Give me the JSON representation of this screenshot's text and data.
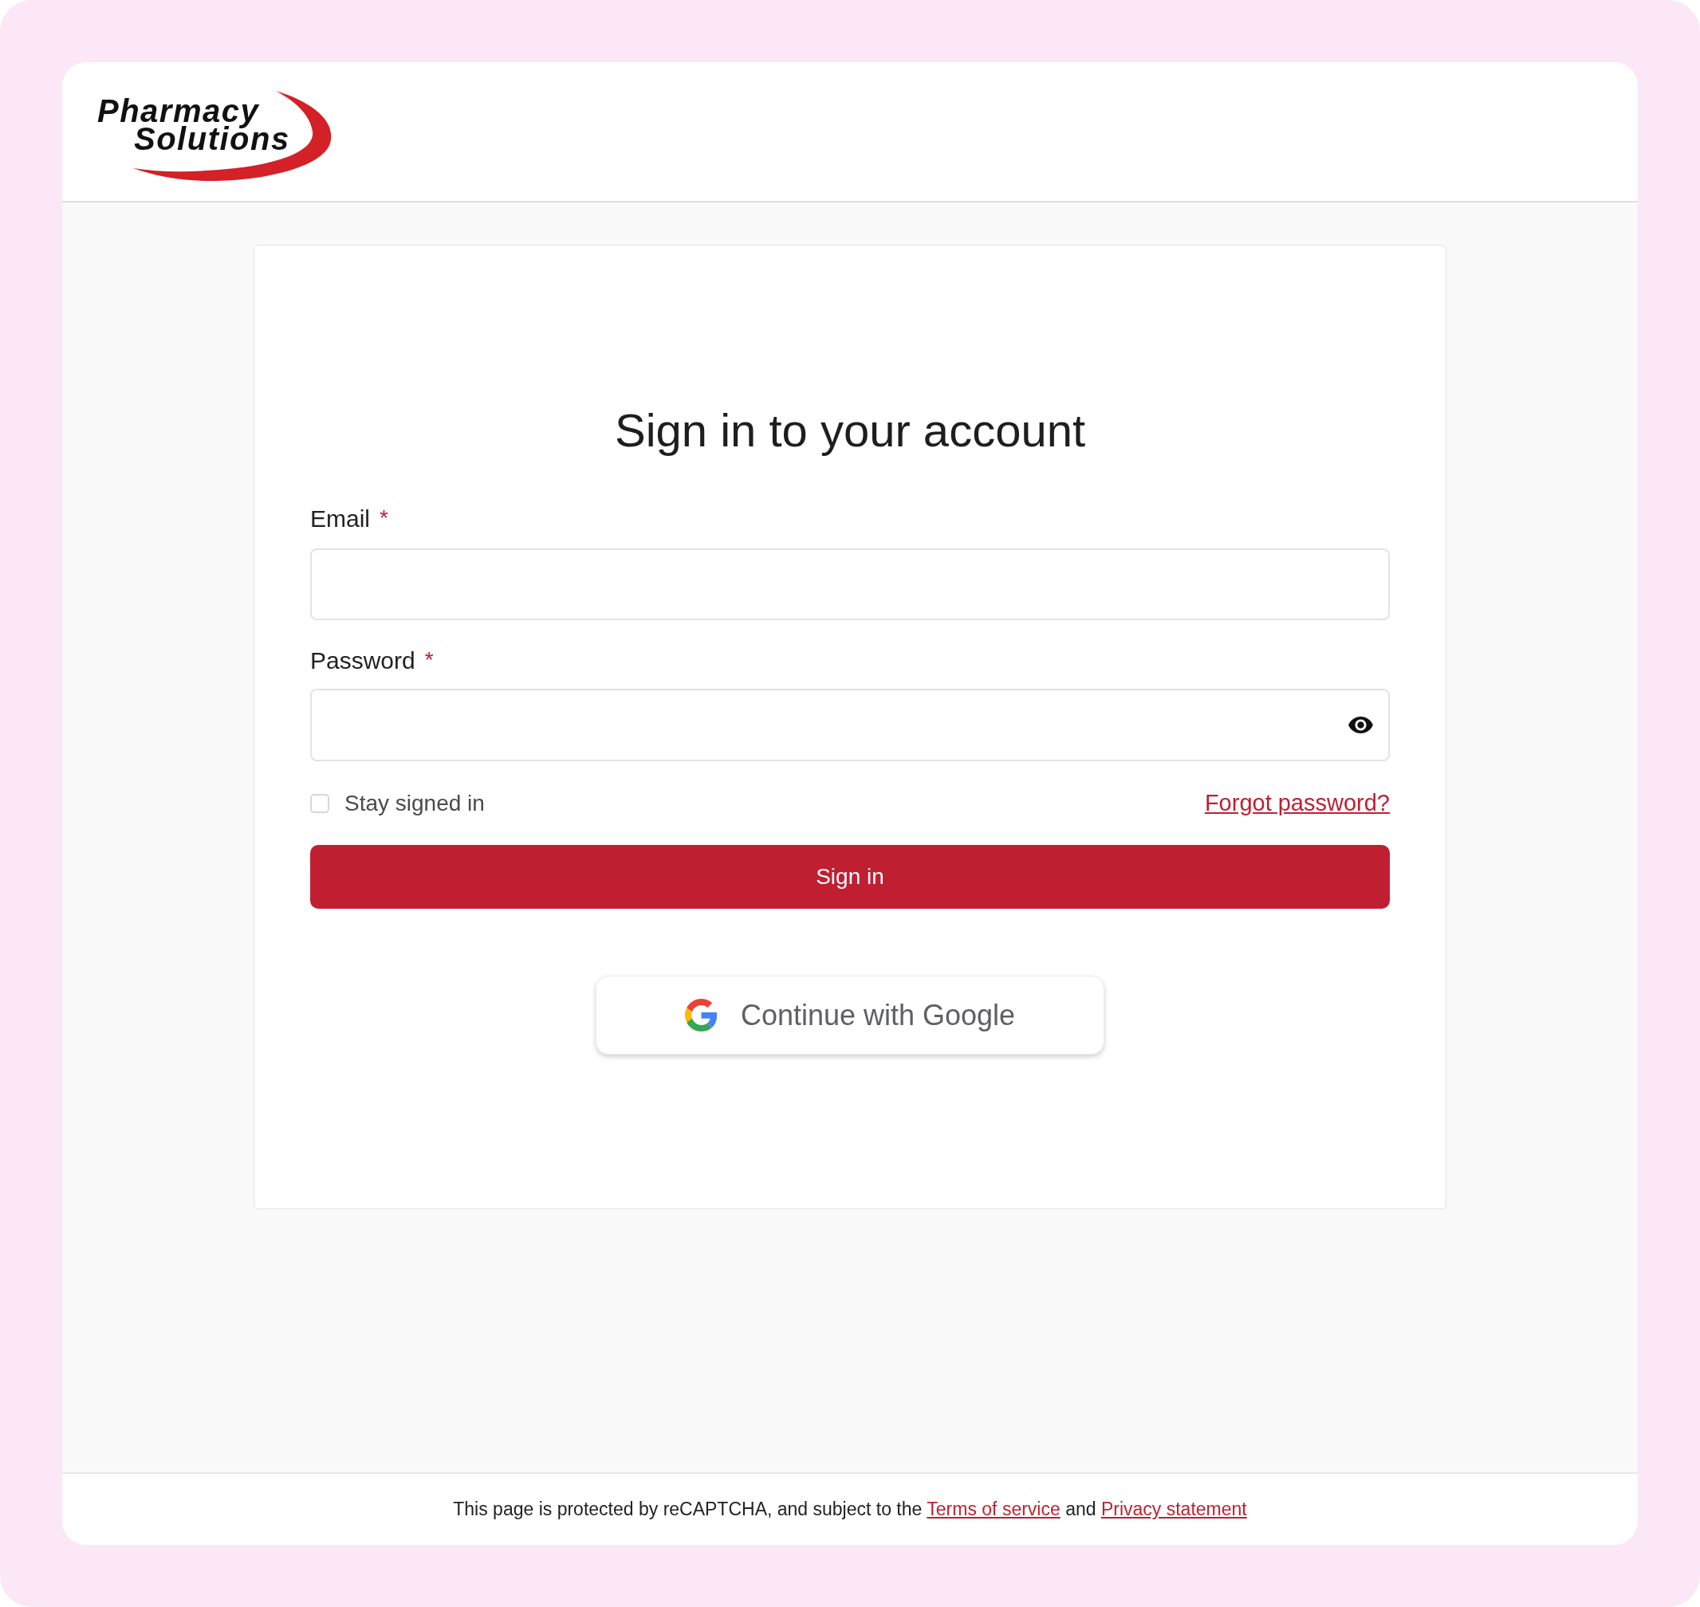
{
  "logo": {
    "lines": [
      "Pharmacy",
      "Solutions"
    ]
  },
  "form": {
    "title": "Sign in to your account",
    "fields": [
      {
        "kind": "email",
        "label": "Email",
        "required_mark": "*"
      },
      {
        "kind": "password",
        "label": "Password",
        "required_mark": "*"
      }
    ],
    "stay_signed_in": {
      "label": "Stay signed in",
      "checked": false
    },
    "forgot_link": "Forgot password?",
    "submit_button": "Sign in",
    "google_button": "Continue with Google"
  },
  "footer": {
    "parts": [
      {
        "kind": "text",
        "text": "This page is protected by reCAPTCHA, and subject to the"
      },
      {
        "kind": "link",
        "text": "Terms of service"
      },
      {
        "kind": "text",
        "text": "and"
      },
      {
        "kind": "link",
        "text": "Privacy statement"
      }
    ]
  }
}
